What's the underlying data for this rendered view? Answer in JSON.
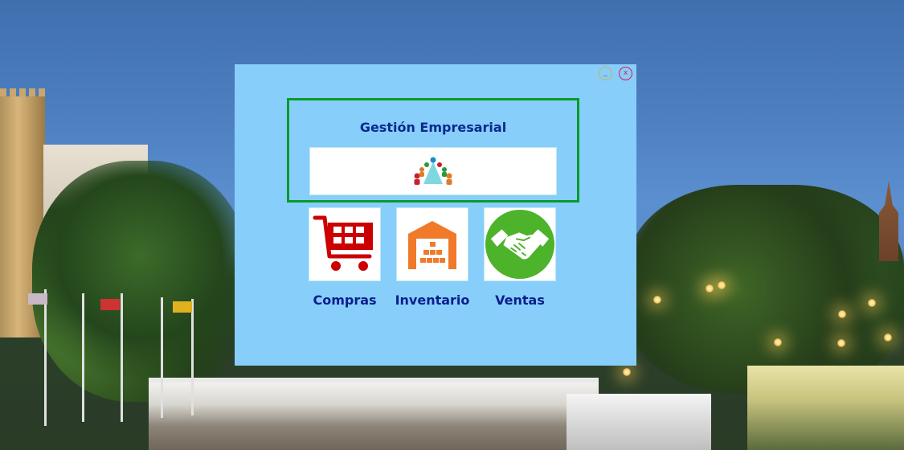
{
  "window": {
    "title": "Gestión Empresarial",
    "minimize_label": "_",
    "close_label": "x"
  },
  "modules": [
    {
      "label": "Compras",
      "icon": "shopping-cart-icon",
      "color": "#cc0000"
    },
    {
      "label": "Inventario",
      "icon": "warehouse-icon",
      "color": "#f07a2a"
    },
    {
      "label": "Ventas",
      "icon": "handshake-icon",
      "color": "#4aaa2a"
    }
  ],
  "colors": {
    "window_bg": "#87cefa",
    "frame_border": "#0a9a2a",
    "title_text": "#0a2a8c",
    "label_text": "#0a1e8c"
  }
}
